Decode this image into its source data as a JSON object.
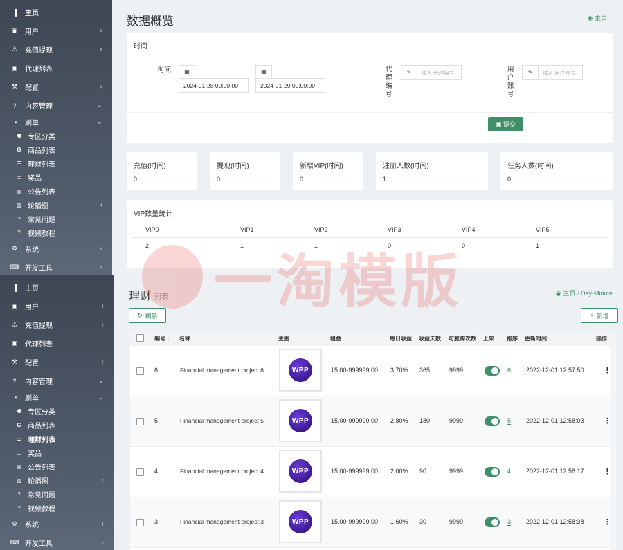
{
  "sidebar_top": {
    "items": [
      {
        "label": "主页",
        "icon": "bar-chart-icon",
        "bold": true
      },
      {
        "label": "用户",
        "icon": "user-icon",
        "chev": "‹"
      },
      {
        "label": "充值提现",
        "icon": "anchor-icon",
        "chev": "‹"
      },
      {
        "label": "代理列表",
        "icon": "user-icon"
      },
      {
        "label": "配置",
        "icon": "magic-icon",
        "chev": "‹"
      },
      {
        "label": "内容管理",
        "icon": "question-icon",
        "chev": "⌄"
      },
      {
        "label": "刷单",
        "icon": "adjust-icon",
        "chev": "⌄"
      },
      {
        "label": "专区分类",
        "icon": "dot-icon"
      },
      {
        "label": "商品列表",
        "icon": "g-icon"
      },
      {
        "label": "理财列表",
        "icon": "list-icon"
      },
      {
        "label": "奖品",
        "icon": "money-icon"
      },
      {
        "label": "公告列表",
        "icon": "doc-icon"
      },
      {
        "label": "轮播图",
        "icon": "image-icon",
        "chev": "‹"
      },
      {
        "label": "常见问题",
        "icon": "question-icon"
      },
      {
        "label": "视频教程",
        "icon": "question-icon"
      },
      {
        "label": "系统",
        "icon": "gear-icon",
        "chev": "‹"
      },
      {
        "label": "开发工具",
        "icon": "keyboard-icon",
        "chev": "‹"
      }
    ]
  },
  "sidebar_bottom": {
    "items": [
      {
        "label": "主页"
      },
      {
        "label": "用户",
        "chev": "‹"
      },
      {
        "label": "充值提现",
        "chev": "‹"
      },
      {
        "label": "代理列表"
      },
      {
        "label": "配置",
        "chev": "‹"
      },
      {
        "label": "内容管理",
        "chev": "⌄"
      },
      {
        "label": "刷单",
        "chev": "⌄"
      },
      {
        "label": "专区分类"
      },
      {
        "label": "商品列表"
      },
      {
        "label": "理财列表"
      },
      {
        "label": "奖品"
      },
      {
        "label": "公告列表"
      },
      {
        "label": "轮播图",
        "chev": "‹"
      },
      {
        "label": "常见问题"
      },
      {
        "label": "视频教程"
      },
      {
        "label": "系统",
        "chev": "‹"
      },
      {
        "label": "开发工具",
        "chev": "‹"
      }
    ]
  },
  "overview": {
    "title": "数据概览",
    "breadcrumb": "主页",
    "form": {
      "section_title": "时间",
      "time_label": "时间",
      "date_start": "2024-01-28 00:00:00",
      "date_end": "2024-01-29 00:00:00",
      "agent_label": "代\n理\n编\n号",
      "agent_placeholder": "输入 代理编号",
      "user_label": "用\n户\n账\n号",
      "user_placeholder": "输入 用户账号",
      "submit": "提交"
    },
    "stats": [
      {
        "title": "充值(时间)",
        "value": "0"
      },
      {
        "title": "提现(时间)",
        "value": "0"
      },
      {
        "title": "新增VIP(时间)",
        "value": "0"
      },
      {
        "title": "注册人数(时间)",
        "value": "1"
      },
      {
        "title": "任务人数(时间)",
        "value": "0"
      }
    ],
    "vip": {
      "title": "VIP数量统计",
      "headers": [
        "VIP0",
        "VIP1",
        "VIP2",
        "VIP3",
        "VIP4",
        "VIP5"
      ],
      "values": [
        "2",
        "1",
        "1",
        "0",
        "0",
        "1"
      ]
    }
  },
  "watermark": {
    "text": "一淘模版"
  },
  "finance": {
    "title": "理财",
    "subtitle": "列表",
    "breadcrumb_home": "主页",
    "breadcrumb_sep": "/",
    "breadcrumb_current": "Day-Minute",
    "refresh": "刷新",
    "add": "新增",
    "headers": {
      "id": "编号",
      "name": "名称",
      "image": "主图",
      "rent": "租金",
      "daily": "每日收益",
      "days": "收益天数",
      "repeat": "可复购次数",
      "shelf": "上架",
      "sort": "排序",
      "updated": "更新时间",
      "action": "操作"
    },
    "rows": [
      {
        "id": "6",
        "name": "Financial management project 6",
        "logo": "WPP",
        "rent": "15.00-999999.00",
        "daily": "3.70%",
        "days": "365",
        "repeat": "9999",
        "sort": "6",
        "updated": "2022-12-01 12:57:50"
      },
      {
        "id": "5",
        "name": "Financial management project 5",
        "logo": "WPP",
        "rent": "15.00-999999.00",
        "daily": "2.80%",
        "days": "180",
        "repeat": "9999",
        "sort": "5",
        "updated": "2022-12-01 12:58:03"
      },
      {
        "id": "4",
        "name": "Financial management project 4",
        "logo": "WPP",
        "rent": "15.00-999999.00",
        "daily": "2.00%",
        "days": "90",
        "repeat": "9999",
        "sort": "4",
        "updated": "2022-12-01 12:58:17"
      },
      {
        "id": "3",
        "name": "Financial management project 3",
        "logo": "WPP",
        "rent": "15.00-999999.00",
        "daily": "1.60%",
        "days": "30",
        "repeat": "9999",
        "sort": "3",
        "updated": "2022-12-01 12:58:38"
      }
    ]
  },
  "colors": {
    "accent": "#3f8f68",
    "sidebar": "#4e5967",
    "watermark": "#e7463c"
  }
}
